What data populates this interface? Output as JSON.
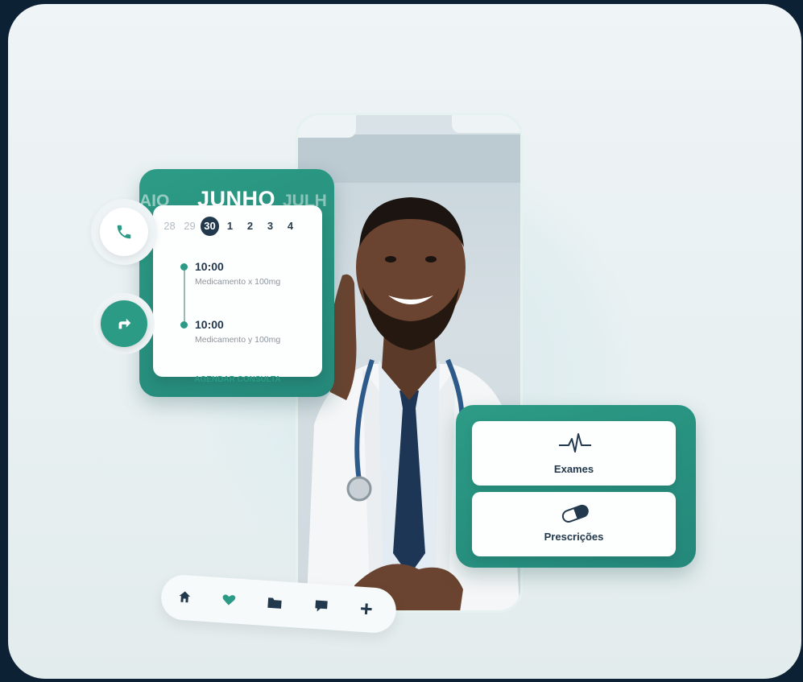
{
  "calendar": {
    "months": {
      "prev": "AIO",
      "current": "JUNHO",
      "next": "JULH"
    },
    "days": [
      {
        "label": "28",
        "state": "muted"
      },
      {
        "label": "29",
        "state": "muted"
      },
      {
        "label": "30",
        "state": "selected"
      },
      {
        "label": "1",
        "state": "normal"
      },
      {
        "label": "2",
        "state": "normal"
      },
      {
        "label": "3",
        "state": "normal"
      },
      {
        "label": "4",
        "state": "normal"
      }
    ],
    "events": [
      {
        "time": "10:00",
        "description": "Medicamento x 100mg"
      },
      {
        "time": "10:00",
        "description": "Medicamento y 100mg"
      }
    ],
    "cta": "AGENDAR CONSULTA"
  },
  "side_buttons": {
    "call_icon": "phone-icon",
    "forward_icon": "share-arrow-icon"
  },
  "exams_card": {
    "items": [
      {
        "label": "Exames",
        "icon": "heartbeat-icon"
      },
      {
        "label": "Prescrições",
        "icon": "pill-icon"
      }
    ]
  },
  "bottom_nav": {
    "items": [
      {
        "icon": "home-icon"
      },
      {
        "icon": "heart-icon"
      },
      {
        "icon": "folder-icon"
      },
      {
        "icon": "chat-icon"
      },
      {
        "icon": "plus-icon"
      }
    ]
  },
  "colors": {
    "accent": "#2c9b85",
    "dark": "#22384c",
    "background": "#0d2135"
  }
}
